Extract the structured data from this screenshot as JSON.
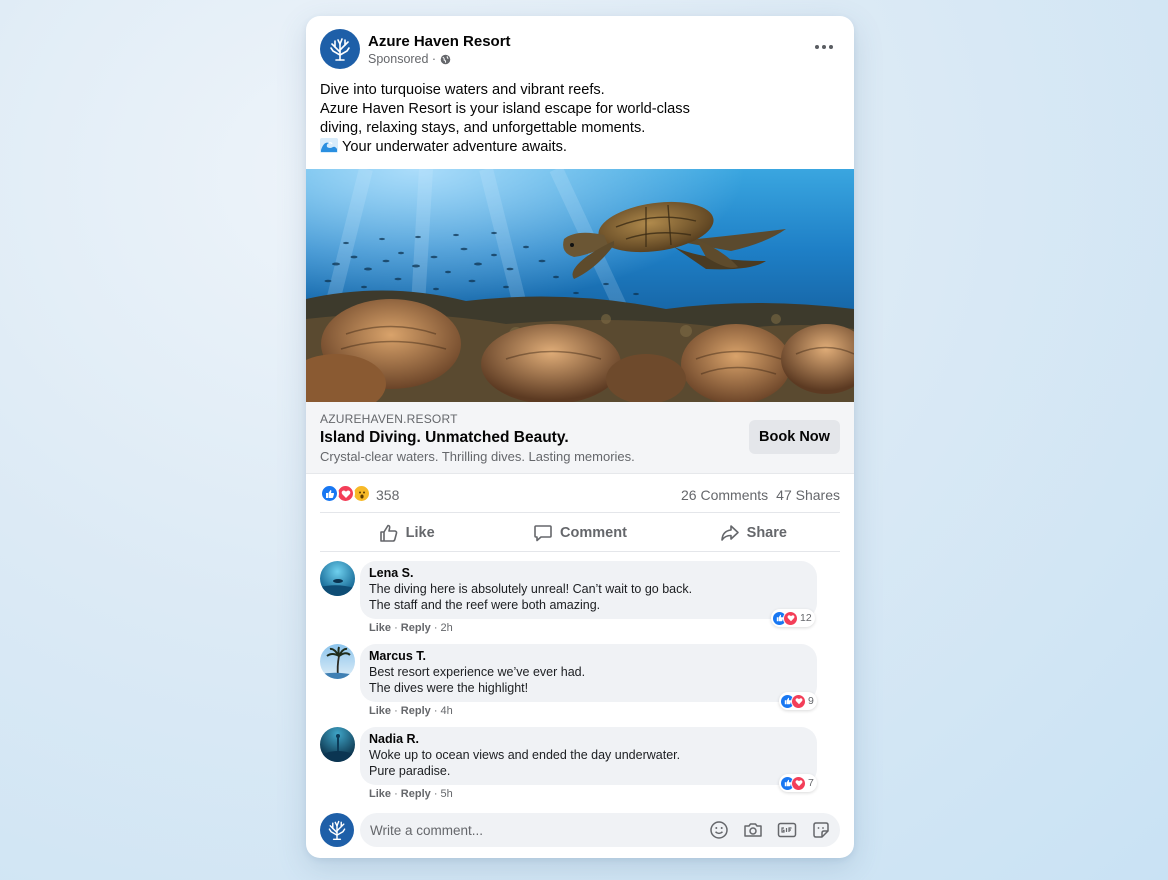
{
  "post": {
    "page_name": "Azure Haven Resort",
    "sponsored_label": "Sponsored ·",
    "more_options_icon": "more-horizontal-icon",
    "caption_lines": [
      "Dive into turquoise waters and vibrant reefs.",
      "Azure Haven Resort is your island escape for world-class",
      "diving, relaxing stays, and unforgettable moments.",
      "Your underwater adventure awaits."
    ],
    "image_alt_subject": "sea turtle over coral reef"
  },
  "link": {
    "domain": "AZUREHAVEN.RESORT",
    "headline": "Island Diving. Unmatched Beauty.",
    "description": "Crystal-clear waters. Thrilling dives. Lasting memories.",
    "cta_label": "Book Now"
  },
  "stats": {
    "reaction_count": "358",
    "comments": "26 Comments",
    "shares": "47 Shares"
  },
  "actions": {
    "like": "Like",
    "comment": "Comment",
    "share": "Share"
  },
  "comments": [
    {
      "author": "Lena S.",
      "lines": [
        "The diving here is absolutely unreal! Can’t wait to go back.",
        "The staff and the reef were both amazing."
      ],
      "like": "Like",
      "reply": "Reply",
      "time": "· 2h",
      "reactions": "12"
    },
    {
      "author": "Marcus T.",
      "lines": [
        "Best resort experience we’ve ever had.",
        "The dives were the highlight!"
      ],
      "like": "Like",
      "reply": "Reply",
      "time": "· 4h",
      "reactions": "9"
    },
    {
      "author": "Nadia R.",
      "lines": [
        "Woke up to ocean views and ended the day underwater.",
        "Pure paradise."
      ],
      "like": "Like",
      "reply": "Reply",
      "time": "· 5h",
      "reactions": "7"
    }
  ],
  "composer": {
    "placeholder": "Write a comment...",
    "icons": [
      "emoji-icon",
      "camera-icon",
      "gif-icon",
      "sticker-icon"
    ]
  },
  "colors": {
    "brand": "#1e5fa8",
    "like_blue": "#1877f2",
    "love_red": "#f33e58",
    "wow_yellow": "#f7b928"
  }
}
